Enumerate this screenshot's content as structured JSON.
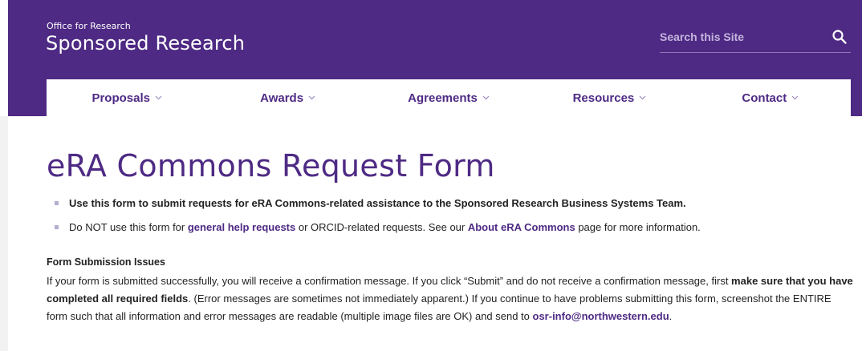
{
  "header": {
    "org_small": "Office for Research",
    "org_big": "Sponsored Research",
    "search_placeholder": "Search this Site",
    "brand_color": "#4e2a84"
  },
  "nav": {
    "items": [
      {
        "label": "Proposals"
      },
      {
        "label": "Awards"
      },
      {
        "label": "Agreements"
      },
      {
        "label": "Resources"
      },
      {
        "label": "Contact"
      }
    ]
  },
  "main": {
    "title": "eRA Commons Request Form",
    "bullet1": "Use this form to submit requests for eRA Commons-related assistance to the Sponsored Research Business Systems Team.",
    "bullet2": {
      "pre": "Do NOT use this form for ",
      "link1": "general help requests",
      "mid": " or ORCID-related requests. See our ",
      "link2": "About eRA Commons",
      "post": " page for more information."
    },
    "issues_heading": "Form Submission Issues",
    "issues": {
      "part1": "If your form is submitted successfully, you will receive a confirmation message. If you click “Submit” and do not receive a confirmation message, first ",
      "bold": "make sure that you have completed all required fields",
      "part2": ". (Error messages are sometimes not immediately apparent.) If you continue to have problems submitting this form, screenshot the ENTIRE form such that all information and error messages are readable (multiple image files are OK) and send to ",
      "email": "osr-info@northwestern.edu",
      "part3": "."
    }
  }
}
